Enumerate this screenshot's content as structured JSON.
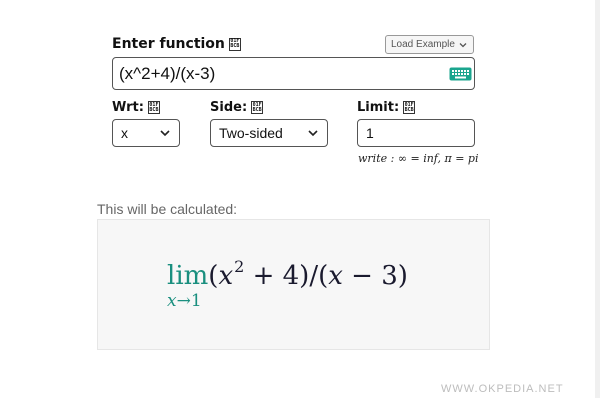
{
  "function_section": {
    "label": "Enter function",
    "load_example": "Load Example",
    "input_value": "(x^2+4)/(x-3)"
  },
  "glyph": {
    "top": "01F",
    "bottom": "BCB"
  },
  "wrt": {
    "label": "Wrt:",
    "selected": "x"
  },
  "side": {
    "label": "Side:",
    "selected": "Two-sided"
  },
  "limit": {
    "label": "Limit:",
    "value": "1"
  },
  "hint": "write : ∞ = inf, π = pi",
  "preview": {
    "label": "This will be calculated:",
    "lim": "lim",
    "sub_var": "x",
    "sub_arrow": "→",
    "sub_value": "1",
    "open_paren": "(",
    "var": "x",
    "exponent": "2",
    "plus_part": " + 4)/(",
    "var2": "x",
    "minus_part": " − 3)"
  },
  "watermark": "WWW.OKPEDIA.NET",
  "colors": {
    "accent": "#1a8f7f",
    "keyboard_icon": "#1aa58e"
  },
  "icons": [
    "keyboard-icon",
    "chevron-down-icon"
  ]
}
